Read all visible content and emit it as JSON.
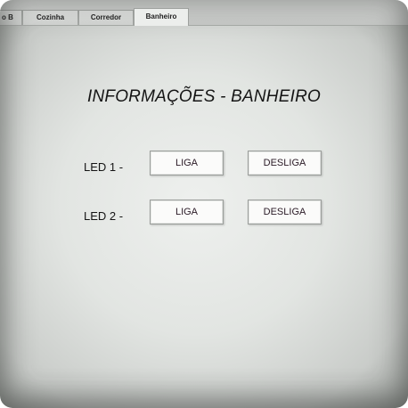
{
  "tabs": [
    {
      "label": "o B"
    },
    {
      "label": "Cozinha"
    },
    {
      "label": "Corredor"
    },
    {
      "label": "Banheiro",
      "active": true
    }
  ],
  "page": {
    "title": "INFORMAÇÕES - BANHEIRO"
  },
  "leds": [
    {
      "label": "LED 1 -",
      "on_label": "LIGA",
      "off_label": "DESLIGA"
    },
    {
      "label": "LED 2 -",
      "on_label": "LIGA",
      "off_label": "DESLIGA"
    }
  ]
}
